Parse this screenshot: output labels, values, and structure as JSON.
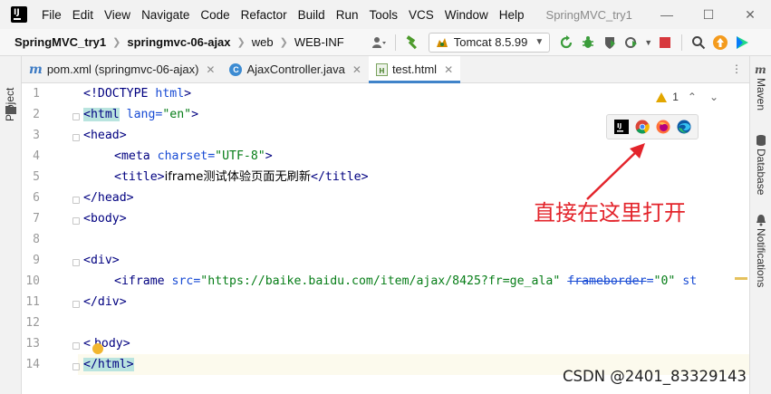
{
  "menubar": {
    "items": [
      "File",
      "Edit",
      "View",
      "Navigate",
      "Code",
      "Refactor",
      "Build",
      "Run",
      "Tools",
      "VCS",
      "Window",
      "Help"
    ],
    "window_title": "SpringMVC_try1",
    "minimize": "—",
    "maximize": "☐",
    "close": "✕"
  },
  "navbar": {
    "breadcrumbs": [
      "SpringMVC_try1",
      "springmvc-06-ajax",
      "web",
      "WEB-INF"
    ],
    "run_config": "Tomcat 8.5.99"
  },
  "left_panel": {
    "label": "Project"
  },
  "right_panel": {
    "labels": [
      "Maven",
      "Database",
      "Notifications"
    ]
  },
  "tabs": [
    {
      "icon": "m",
      "label": "pom.xml (springmvc-06-ajax)"
    },
    {
      "icon": "C",
      "label": "AjaxController.java"
    },
    {
      "icon": "H",
      "label": "test.html"
    }
  ],
  "editor": {
    "line_numbers": [
      "1",
      "2",
      "3",
      "4",
      "5",
      "6",
      "7",
      "8",
      "9",
      "10",
      "11",
      "12",
      "13",
      "14"
    ],
    "inspection_count": "1",
    "lines": {
      "l1_doctype": "<!DOCTYPE ",
      "l1_html": "html",
      "l1_end": ">",
      "l2_open": "<html",
      "l2_attr": " lang=",
      "l2_val": "\"en\"",
      "l2_end": ">",
      "l3": "<head>",
      "l4_open": "<meta",
      "l4_attr": " charset=",
      "l4_val": "\"UTF-8\"",
      "l4_end": ">",
      "l5_open": "<title>",
      "l5_text": "iframe测试体验页面无刷新",
      "l5_close": "</title>",
      "l6": "</head>",
      "l7": "<body>",
      "l9": "<div>",
      "l10_open": "<iframe",
      "l10_attr1": " src=",
      "l10_val1": "\"https://baike.baidu.com/item/ajax/8425?fr=ge_ala\"",
      "l10_attr2": "frameborder",
      "l10_eq": "=",
      "l10_val2": "\"0\"",
      "l10_tail": " st",
      "l11": "</div>",
      "l13_open": "<",
      "l13_rest": "body>",
      "l14": "</html>"
    }
  },
  "annotation": {
    "text": "直接在这里打开"
  },
  "watermark": "CSDN @2401_83329143",
  "colors": {
    "accent": "#4083c9",
    "annotation": "#e3242b",
    "tag": "#000080",
    "string": "#067d17",
    "attribute": "#174ad4"
  }
}
